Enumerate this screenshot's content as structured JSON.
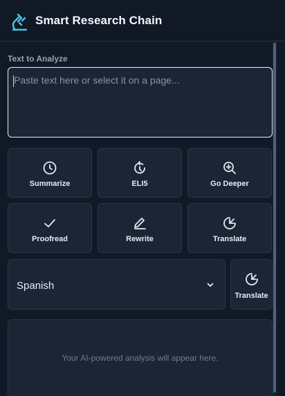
{
  "header": {
    "title": "Smart Research Chain",
    "logo_icon": "microscope-icon"
  },
  "input": {
    "label": "Text to Analyze",
    "placeholder": "Paste text here or select it on a page..."
  },
  "actions": [
    {
      "label": "Summarize",
      "icon": "clock-icon"
    },
    {
      "label": "ELI5",
      "icon": "refresh-icon"
    },
    {
      "label": "Go Deeper",
      "icon": "zoom-in-icon"
    },
    {
      "label": "Proofread",
      "icon": "check-icon"
    },
    {
      "label": "Rewrite",
      "icon": "pencil-icon"
    },
    {
      "label": "Translate",
      "icon": "translate-icon"
    }
  ],
  "translation": {
    "selected_language": "Spanish",
    "button_label": "Translate",
    "button_icon": "translate-icon"
  },
  "output": {
    "placeholder": "Your AI-powered analysis will appear here."
  },
  "colors": {
    "background": "#111927",
    "card": "#1b2535",
    "accent": "#4fc3e8",
    "text": "#e6ebf2",
    "muted": "#94a3b8"
  }
}
